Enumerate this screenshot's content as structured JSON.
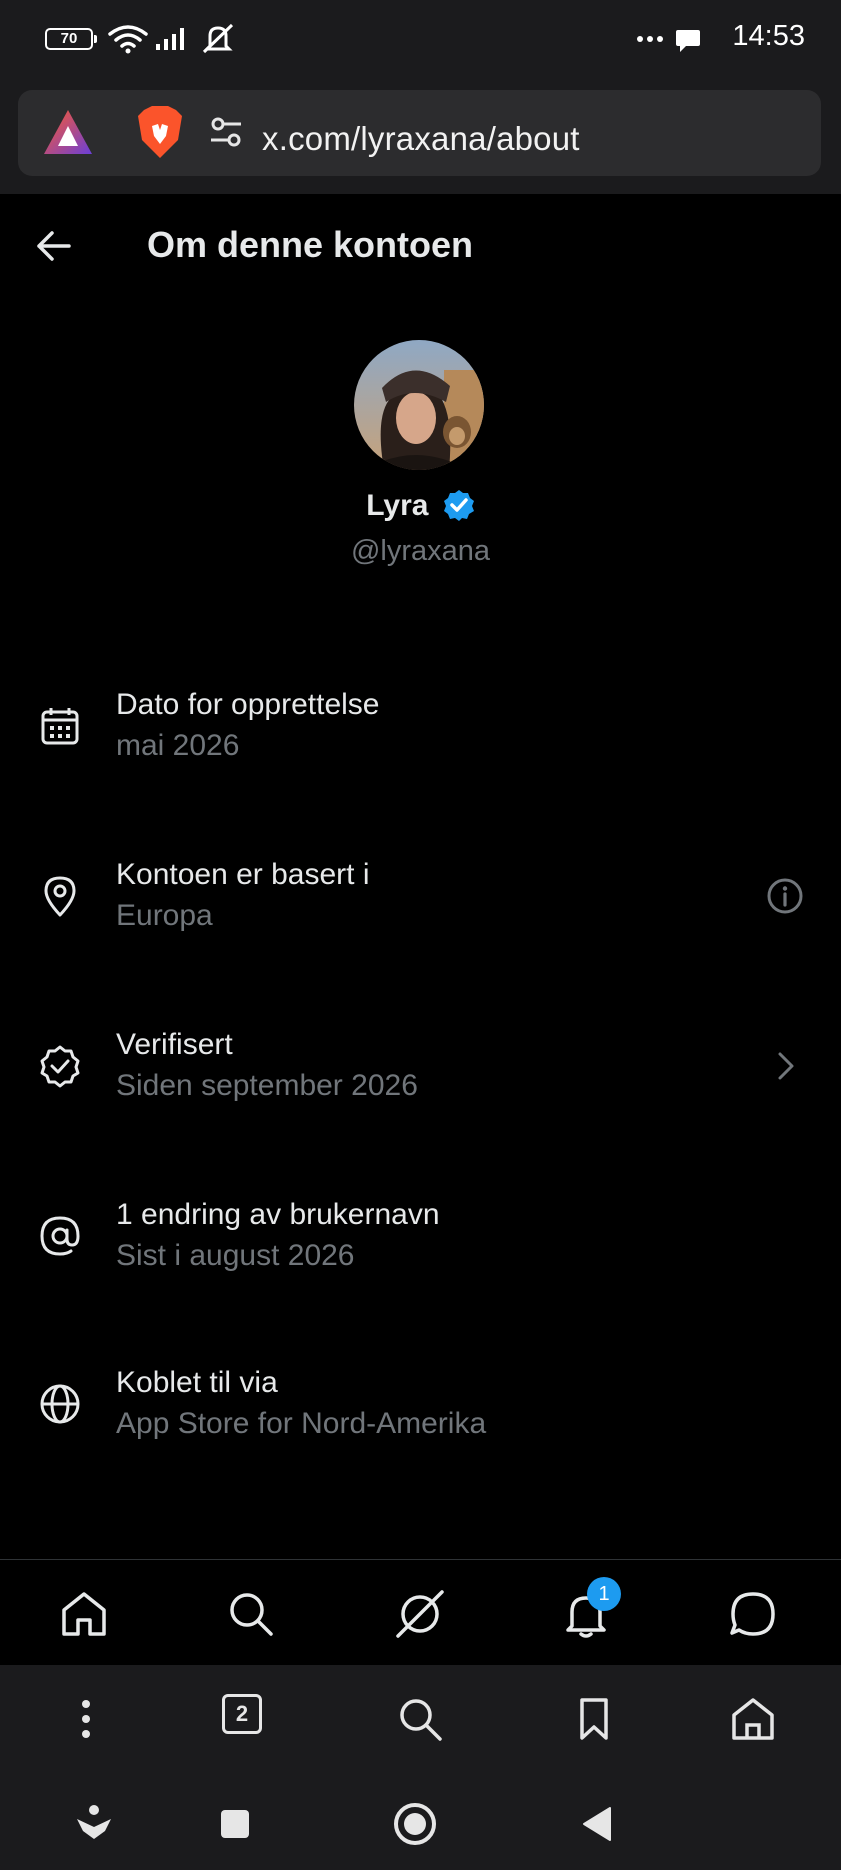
{
  "status_bar": {
    "battery": "70",
    "time": "14:53",
    "icons": [
      "wifi-icon",
      "signal-icon",
      "mute-icon",
      "more-dots-icon",
      "chat-bubble-icon"
    ]
  },
  "browser": {
    "url": "x.com/lyraxana/about",
    "icons": [
      "brave-rewards-icon",
      "brave-lion-icon",
      "site-settings-icon"
    ]
  },
  "header": {
    "title": "Om denne kontoen",
    "back_icon": "arrow-left-icon"
  },
  "profile": {
    "name": "Lyra",
    "handle": "@lyraxana",
    "verified": true,
    "verified_color": "#1d9bf0"
  },
  "rows": [
    {
      "icon": "calendar-icon",
      "label": "Dato for opprettelse",
      "value": "mai 2026",
      "trailing": null
    },
    {
      "icon": "location-pin-icon",
      "label": "Kontoen er basert i",
      "value": "Europa",
      "trailing": "info-icon"
    },
    {
      "icon": "verified-badge-icon",
      "label": "Verifisert",
      "value": "Siden september 2026",
      "trailing": "chevron-right-icon"
    },
    {
      "icon": "at-sign-icon",
      "label": "1 endring av brukernavn",
      "value": "Sist i august 2026",
      "trailing": null
    },
    {
      "icon": "globe-icon",
      "label": "Koblet til via",
      "value": "App Store for Nord-Amerika",
      "trailing": null
    }
  ],
  "tab_bar": {
    "tabs": [
      "home-icon",
      "search-icon",
      "grok-icon",
      "bell-icon",
      "messages-icon"
    ],
    "notification_badge": "1",
    "badge_color": "#1d9bf0"
  },
  "browser_toolbar": {
    "tab_count": "2",
    "icons": [
      "menu-dots-icon",
      "tab-count-icon",
      "search-icon",
      "bookmark-icon",
      "home-icon"
    ]
  },
  "nav_bar": {
    "icons": [
      "assistant-icon",
      "recents-square-icon",
      "home-circle-icon",
      "back-triangle-icon"
    ]
  },
  "colors": {
    "background": "#000000",
    "primary_text": "#e7e9ea",
    "secondary_text": "#71767b",
    "accent": "#1d9bf0"
  }
}
